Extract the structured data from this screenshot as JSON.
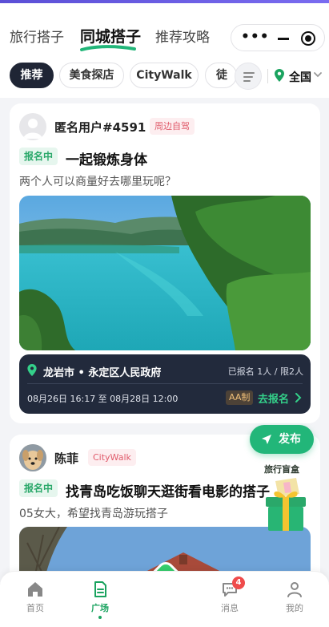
{
  "header": {
    "tabs": [
      {
        "label": "旅行搭子"
      },
      {
        "label": "同城搭子"
      },
      {
        "label": "推荐攻略"
      }
    ],
    "more_icon": "ellipsis-icon",
    "close_icon": "record-icon"
  },
  "filters": {
    "chips": [
      {
        "label": "推荐"
      },
      {
        "label": "美食探店"
      },
      {
        "label": "CityWalk"
      },
      {
        "label": "徒"
      }
    ],
    "city": "全国"
  },
  "posts": [
    {
      "user": "匿名用户#4591",
      "tag": "周边自驾",
      "status": "报名中",
      "title": "一起锻炼身体",
      "desc": "两个人可以商量好去哪里玩呢？",
      "location": "龙岩市 • 永定区人民政府",
      "count": "已报名 1人 / 限2人",
      "time": "08月26日 16:17 至 08月28日 12:00",
      "payment": "AA制",
      "action": "去报名"
    },
    {
      "user": "陈菲",
      "tag": "CityWalk",
      "status": "报名中",
      "title": "找青岛吃饭聊天逛街看电影的搭子",
      "desc": "05女大，希望找青岛游玩搭子"
    }
  ],
  "publish_label": "发布",
  "blindbox_label": "旅行盲盒",
  "tabbar": [
    {
      "label": "首页"
    },
    {
      "label": "广场"
    },
    {
      "label": "消息",
      "badge": "4"
    },
    {
      "label": "我的"
    }
  ],
  "colors": {
    "accent": "#22b679",
    "dark": "#1f2535",
    "tag_red": "#e05a6a"
  }
}
